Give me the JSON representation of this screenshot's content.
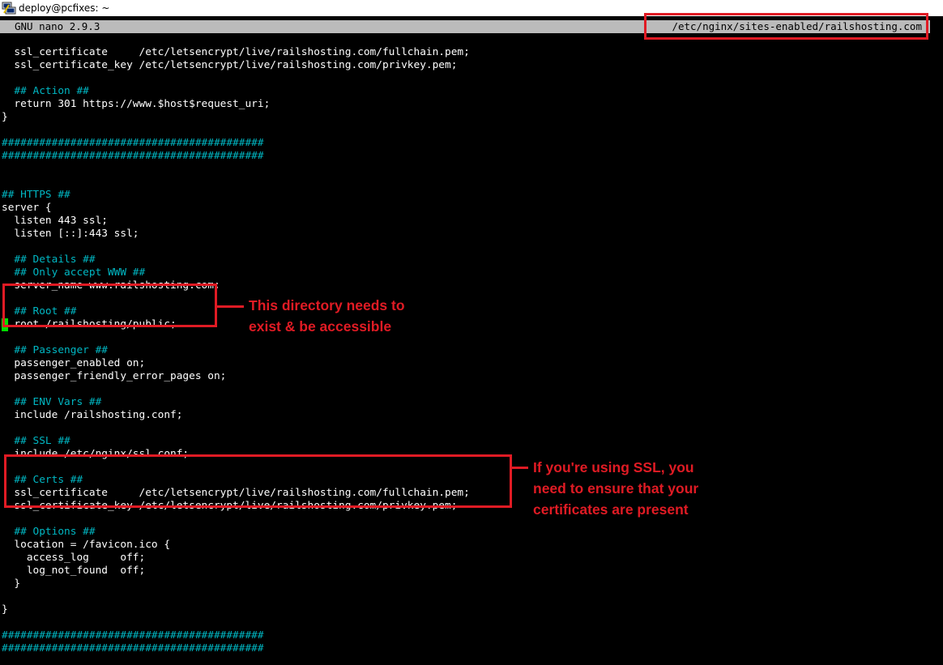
{
  "window": {
    "title": "deploy@pcfixes: ~",
    "icon": "putty-icon"
  },
  "nano": {
    "version": "GNU nano 2.9.3",
    "filename": "/etc/nginx/sites-enabled/railshosting.com"
  },
  "lines": [
    "  ssl_certificate     /etc/letsencrypt/live/railshosting.com/fullchain.pem;",
    "  ssl_certificate_key /etc/letsencrypt/live/railshosting.com/privkey.pem;",
    "",
    "  ## Action ##",
    "  return 301 https://www.$host$request_uri;",
    "}",
    "",
    "##########################################",
    "##########################################",
    "",
    "",
    "## HTTPS ##",
    "server {",
    "  listen 443 ssl;",
    "  listen [::]:443 ssl;",
    "",
    "  ## Details ##",
    "  ## Only accept WWW ##",
    "  server_name www.railshosting.com;",
    "",
    "  ## Root ##",
    "  root /railshosting/public;",
    "",
    "  ## Passenger ##",
    "  passenger_enabled on;",
    "  passenger_friendly_error_pages on;",
    "",
    "  ## ENV Vars ##",
    "  include /railshosting.conf;",
    "",
    "  ## SSL ##",
    "  include /etc/nginx/ssl.conf;",
    "",
    "  ## Certs ##",
    "  ssl_certificate     /etc/letsencrypt/live/railshosting.com/fullchain.pem;",
    "  ssl_certificate_key /etc/letsencrypt/live/railshosting.com/privkey.pem;",
    "",
    "  ## Options ##",
    "  location = /favicon.ico {",
    "    access_log     off;",
    "    log_not_found  off;",
    "  }",
    "",
    "}",
    "",
    "##########################################",
    "##########################################"
  ],
  "annotations": {
    "root_note": "This directory needs to\nexist & be accessible",
    "ssl_note": "If you're using SSL, you\nneed to ensure that your\ncertificates are present"
  },
  "colors": {
    "terminal_bg": "#000000",
    "text": "#ffffff",
    "comment": "#00b7c3",
    "header_bg": "#bbbbbb",
    "annotation": "#e01b24",
    "cursor": "#00e000"
  }
}
